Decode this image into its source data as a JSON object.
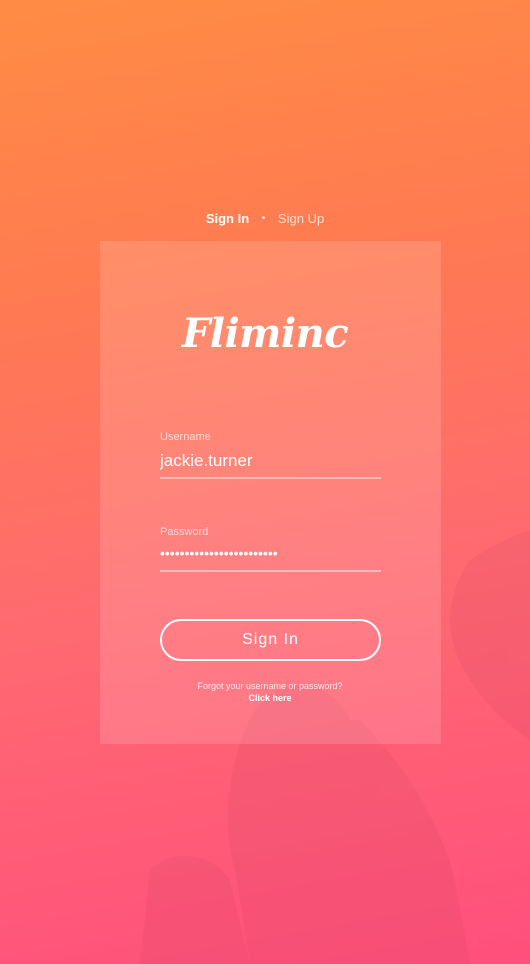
{
  "tabs": {
    "signin": "Sign In",
    "separator": "•",
    "signup": "Sign Up"
  },
  "logo": "Fliminc",
  "username": {
    "label": "Username",
    "value": "jackie.turner"
  },
  "password": {
    "label": "Password",
    "value": "••••••••••••••••••••••••"
  },
  "signin_button": "Sign In",
  "forgot": {
    "text": "Forgot your username or password?",
    "link": "Click here"
  },
  "colors": {
    "gradient_top": "#ff8c44",
    "gradient_bottom": "#ff4f7d",
    "text": "#ffffff"
  }
}
